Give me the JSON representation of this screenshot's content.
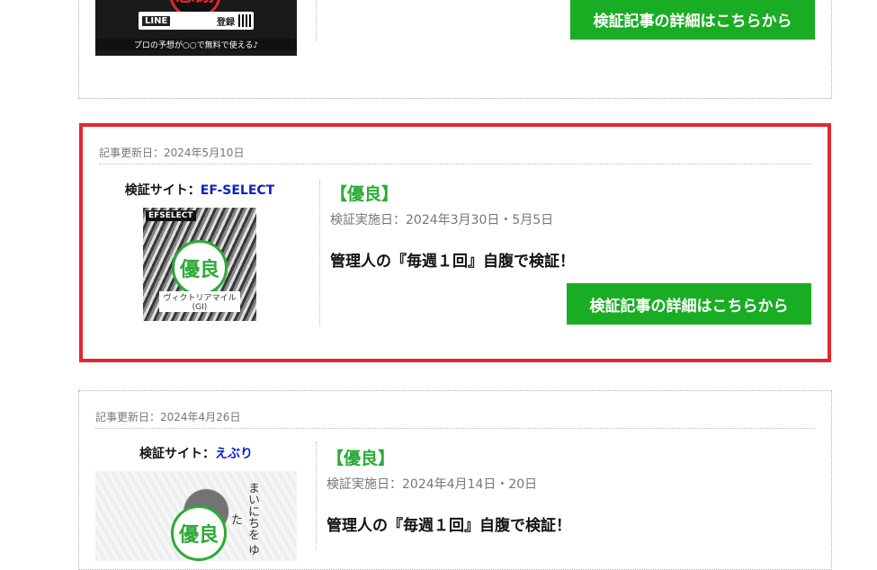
{
  "cards": [
    {
      "thumb_line_badge": "LINE",
      "thumb_register": "登録",
      "thumb_caption": "プロの予想が○○で無料で使える♪",
      "seal_text": "感謝",
      "cta_label": "検証記事の詳細はこちらから"
    },
    {
      "updated": "記事更新日：2024年5月10日",
      "site_label": "検証サイト：",
      "site_name": "EF-SELECT",
      "thumb_logo": "EFSELECT",
      "seal_text": "優良",
      "thumb_caption": "ヴィクトリアマイル(GI)",
      "rating": "【優良】",
      "period": "検証実施日：2024年3月30日・5月5日",
      "headline": "管理人の『毎週１回』自腹で検証！",
      "cta_label": "検証記事の詳細はこちらから"
    },
    {
      "updated": "記事更新日：2024年4月26日",
      "site_label": "検証サイト：",
      "site_name": "えぶり",
      "seal_text": "優良",
      "thumb_vertical": "まいにちを ゆた",
      "rating": "【優良】",
      "period": "検証実施日：2024年4月14日・20日",
      "headline": "管理人の『毎週１回』自腹で検証！"
    }
  ],
  "colors": {
    "accent_green": "#19ad23",
    "rating_green": "#2bab37",
    "highlight_red": "#e3262f",
    "site_link_blue": "#0b1fc7"
  }
}
